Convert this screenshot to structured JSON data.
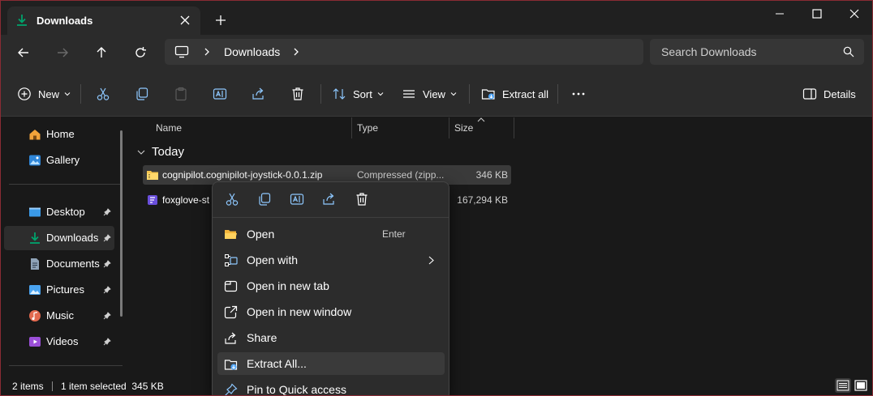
{
  "window": {
    "tab_title": "Downloads",
    "accent": "#00a36c",
    "border_color": "#8a2b34"
  },
  "address": {
    "breadcrumb": "Downloads",
    "search_placeholder": "Search Downloads"
  },
  "commandbar": {
    "new_label": "New",
    "sort_label": "Sort",
    "view_label": "View",
    "extract_label": "Extract all",
    "details_label": "Details"
  },
  "sidebar": {
    "items": [
      {
        "label": "Home",
        "icon": "home-icon"
      },
      {
        "label": "Gallery",
        "icon": "gallery-icon"
      },
      {
        "label": "Desktop",
        "icon": "desktop-icon",
        "pinned": true
      },
      {
        "label": "Downloads",
        "icon": "download-icon",
        "pinned": true,
        "active": true
      },
      {
        "label": "Documents",
        "icon": "documents-icon",
        "pinned": true
      },
      {
        "label": "Pictures",
        "icon": "pictures-icon",
        "pinned": true
      },
      {
        "label": "Music",
        "icon": "music-icon",
        "pinned": true
      },
      {
        "label": "Videos",
        "icon": "videos-icon",
        "pinned": true
      }
    ]
  },
  "filelist": {
    "columns": [
      "Name",
      "Type",
      "Size"
    ],
    "group": "Today",
    "rows": [
      {
        "name": "cognipilot.cognipilot-joystick-0.0.1.zip",
        "type": "Compressed (zipp...",
        "size": "346 KB",
        "selected": true
      },
      {
        "name": "foxglove-st",
        "type": "",
        "size": "167,294 KB",
        "selected": false
      }
    ]
  },
  "statusbar": {
    "count": "2 items",
    "selection": "1 item selected  345 KB"
  },
  "context_menu": {
    "items": [
      {
        "label": "Open",
        "shortcut": "Enter",
        "icon": "folder-open-icon"
      },
      {
        "label": "Open with",
        "shortcut": "",
        "icon": "open-with-icon",
        "submenu": true
      },
      {
        "label": "Open in new tab",
        "shortcut": "",
        "icon": "new-tab-icon"
      },
      {
        "label": "Open in new window",
        "shortcut": "",
        "icon": "new-window-icon"
      },
      {
        "label": "Share",
        "shortcut": "",
        "icon": "share-icon"
      },
      {
        "label": "Extract All...",
        "shortcut": "",
        "icon": "extract-icon",
        "hovered": true
      },
      {
        "label": "Pin to Quick access",
        "shortcut": "",
        "icon": "pin-icon"
      }
    ]
  }
}
